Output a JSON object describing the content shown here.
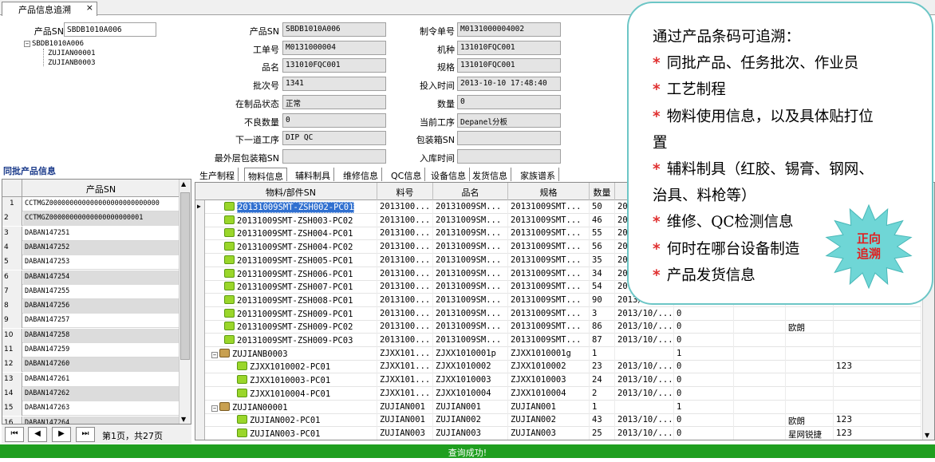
{
  "tab": {
    "title": "产品信息追溯",
    "close": "×"
  },
  "search": {
    "label": "产品SN",
    "value": "SBDB1010A006"
  },
  "tree": {
    "root": "SBDB1010A006",
    "children": [
      "ZUJIAN00001",
      "ZUJIANB0003"
    ]
  },
  "fields": [
    {
      "label": "产品SN",
      "value": "SBDB1010A006"
    },
    {
      "label": "工单号",
      "value": "M0131000004"
    },
    {
      "label": "品名",
      "value": "131010FQC001"
    },
    {
      "label": "批次号",
      "value": "1341"
    },
    {
      "label": "在制品状态",
      "value": "正常"
    },
    {
      "label": "不良数量",
      "value": "0"
    },
    {
      "label": "下一道工序",
      "value": "DIP QC"
    },
    {
      "label": "最外层包装箱SN",
      "value": ""
    }
  ],
  "fields2": [
    {
      "label": "制令单号",
      "value": "M0131000004002"
    },
    {
      "label": "机种",
      "value": "131010FQC001"
    },
    {
      "label": "规格",
      "value": "131010FQC001"
    },
    {
      "label": "投入时间",
      "value": "2013-10-10 17:48:40"
    },
    {
      "label": "数量",
      "value": "0"
    },
    {
      "label": "当前工序",
      "value": "Depanel分板"
    },
    {
      "label": "包装箱SN",
      "value": ""
    },
    {
      "label": "入库时间",
      "value": ""
    }
  ],
  "batch": {
    "title": "同批产品信息",
    "header": "产品SN",
    "rows": [
      "CCTMGZ000000000000000000000000000",
      "CCTMGZ00000000000000000000001",
      "DABAN147251",
      "DABAN147252",
      "DABAN147253",
      "DABAN147254",
      "DABAN147255",
      "DABAN147256",
      "DABAN147257",
      "DABAN147258",
      "DABAN147259",
      "DABAN147260",
      "DABAN147261",
      "DABAN147262",
      "DABAN147263",
      "DABAN147264"
    ],
    "row_nums": [
      "1",
      "2",
      "3",
      "4",
      "5",
      "6",
      "7",
      "8",
      "9",
      "10",
      "11",
      "12",
      "13",
      "14",
      "15",
      "16"
    ],
    "pager": {
      "first": "⏮",
      "prev": "◀",
      "next": "▶",
      "last": "⏭",
      "text": "第1页，共27页"
    }
  },
  "detail_tabs": [
    "生产制程",
    "物料信息",
    "辅料制具",
    "维修信息",
    "QC信息",
    "设备信息",
    "发货信息",
    "家族谱系"
  ],
  "grid": {
    "headers": [
      "物料/部件SN",
      "料号",
      "品名",
      "规格",
      "数量",
      "",
      "",
      "",
      "",
      ""
    ],
    "rows": [
      {
        "sn": "20131009SMT-ZSH002-PC01",
        "pn": "2013100...",
        "name": "20131009SM...",
        "spec": "20131009SMT...",
        "qty": "50",
        "date": "20",
        "c6": "",
        "c7": "",
        "c8": "",
        "c9": "",
        "lvl": 1,
        "kind": "pkg"
      },
      {
        "sn": "20131009SMT-ZSH003-PC02",
        "pn": "2013100...",
        "name": "20131009SM...",
        "spec": "20131009SMT...",
        "qty": "46",
        "date": "20",
        "c6": "",
        "c7": "",
        "c8": "",
        "c9": "",
        "lvl": 1,
        "kind": "pkg"
      },
      {
        "sn": "20131009SMT-ZSH004-PC01",
        "pn": "2013100...",
        "name": "20131009SM...",
        "spec": "20131009SMT...",
        "qty": "55",
        "date": "20",
        "c6": "",
        "c7": "",
        "c8": "",
        "c9": "",
        "lvl": 1,
        "kind": "pkg"
      },
      {
        "sn": "20131009SMT-ZSH004-PC02",
        "pn": "2013100...",
        "name": "20131009SM...",
        "spec": "20131009SMT...",
        "qty": "56",
        "date": "20",
        "c6": "",
        "c7": "",
        "c8": "",
        "c9": "",
        "lvl": 1,
        "kind": "pkg"
      },
      {
        "sn": "20131009SMT-ZSH005-PC01",
        "pn": "2013100...",
        "name": "20131009SM...",
        "spec": "20131009SMT...",
        "qty": "35",
        "date": "20",
        "c6": "",
        "c7": "",
        "c8": "",
        "c9": "",
        "lvl": 1,
        "kind": "pkg"
      },
      {
        "sn": "20131009SMT-ZSH006-PC01",
        "pn": "2013100...",
        "name": "20131009SM...",
        "spec": "20131009SMT...",
        "qty": "34",
        "date": "20",
        "c6": "",
        "c7": "",
        "c8": "",
        "c9": "",
        "lvl": 1,
        "kind": "pkg"
      },
      {
        "sn": "20131009SMT-ZSH007-PC01",
        "pn": "2013100...",
        "name": "20131009SM...",
        "spec": "20131009SMT...",
        "qty": "54",
        "date": "2013/",
        "c6": "",
        "c7": "",
        "c8": "",
        "c9": "",
        "lvl": 1,
        "kind": "pkg"
      },
      {
        "sn": "20131009SMT-ZSH008-PC01",
        "pn": "2013100...",
        "name": "20131009SM...",
        "spec": "20131009SMT...",
        "qty": "90",
        "date": "2013/10",
        "c6": "",
        "c7": "",
        "c8": "",
        "c9": "",
        "lvl": 1,
        "kind": "pkg"
      },
      {
        "sn": "20131009SMT-ZSH009-PC01",
        "pn": "2013100...",
        "name": "20131009SM...",
        "spec": "20131009SMT...",
        "qty": "3",
        "date": "2013/10/...",
        "c6": "0",
        "c7": "",
        "c8": "",
        "c9": "",
        "lvl": 1,
        "kind": "pkg"
      },
      {
        "sn": "20131009SMT-ZSH009-PC02",
        "pn": "2013100...",
        "name": "20131009SM...",
        "spec": "20131009SMT...",
        "qty": "86",
        "date": "2013/10/...",
        "c6": "0",
        "c7": "",
        "c8": "欧朗",
        "c9": "",
        "lvl": 1,
        "kind": "pkg"
      },
      {
        "sn": "20131009SMT-ZSH009-PC03",
        "pn": "2013100...",
        "name": "20131009SM...",
        "spec": "20131009SMT...",
        "qty": "87",
        "date": "2013/10/...",
        "c6": "0",
        "c7": "",
        "c8": "",
        "c9": "",
        "lvl": 1,
        "kind": "pkg"
      },
      {
        "sn": "ZUJIANB0003",
        "pn": "ZJXX101...",
        "name": "ZJXX1010001p",
        "spec": "ZJXX1010001g",
        "qty": "1",
        "date": "",
        "c6": "1",
        "c7": "",
        "c8": "",
        "c9": "",
        "lvl": 0,
        "kind": "box"
      },
      {
        "sn": "ZJXX1010002-PC01",
        "pn": "ZJXX101...",
        "name": "ZJXX1010002",
        "spec": "ZJXX1010002",
        "qty": "23",
        "date": "2013/10/...",
        "c6": "0",
        "c7": "",
        "c8": "",
        "c9": "123",
        "lvl": 2,
        "kind": "pkg"
      },
      {
        "sn": "ZJXX1010003-PC01",
        "pn": "ZJXX101...",
        "name": "ZJXX1010003",
        "spec": "ZJXX1010003",
        "qty": "24",
        "date": "2013/10/...",
        "c6": "0",
        "c7": "",
        "c8": "",
        "c9": "",
        "lvl": 2,
        "kind": "pkg"
      },
      {
        "sn": "ZJXX1010004-PC01",
        "pn": "ZJXX101...",
        "name": "ZJXX1010004",
        "spec": "ZJXX1010004",
        "qty": "2",
        "date": "2013/10/...",
        "c6": "0",
        "c7": "",
        "c8": "",
        "c9": "",
        "lvl": 2,
        "kind": "pkg"
      },
      {
        "sn": "ZUJIAN00001",
        "pn": "ZUJIAN001",
        "name": "ZUJIAN001",
        "spec": "ZUJIAN001",
        "qty": "1",
        "date": "",
        "c6": "1",
        "c7": "",
        "c8": "",
        "c9": "",
        "lvl": 0,
        "kind": "box"
      },
      {
        "sn": "ZUJIAN002-PC01",
        "pn": "ZUJIAN001",
        "name": "ZUJIAN002",
        "spec": "ZUJIAN002",
        "qty": "43",
        "date": "2013/10/...",
        "c6": "0",
        "c7": "",
        "c8": "欧朗",
        "c9": "123",
        "lvl": 2,
        "kind": "pkg"
      },
      {
        "sn": "ZUJIAN003-PC01",
        "pn": "ZUJIAN003",
        "name": "ZUJIAN003",
        "spec": "ZUJIAN003",
        "qty": "25",
        "date": "2013/10/...",
        "c6": "0",
        "c7": "",
        "c8": "星网锐捷",
        "c9": "123",
        "lvl": 2,
        "kind": "pkg"
      }
    ]
  },
  "status": {
    "text": "查询成功!"
  },
  "callout": {
    "lines": [
      {
        "star": "",
        "text": "通过产品条码可追溯："
      },
      {
        "star": "*",
        "text": "同批产品、任务批次、作业员"
      },
      {
        "star": "*",
        "text": "工艺制程"
      },
      {
        "star": "*",
        "text": "物料使用信息，以及具体贴打位"
      },
      {
        "star": "",
        "text": "置"
      },
      {
        "star": "*",
        "text": "辅料制具（红胶、锡膏、钢网、"
      },
      {
        "star": "",
        "text": "治具、料枪等）"
      },
      {
        "star": "*",
        "text": "维修、QC检测信息"
      },
      {
        "star": "*",
        "text": "何时在哪台设备制造"
      },
      {
        "star": "*",
        "text": "产品发货信息"
      }
    ],
    "badge": [
      "正向",
      "追溯"
    ]
  },
  "colors": {
    "status_bg": "#1f9e1f",
    "callout_border": "#6cc6c6",
    "badge_bg": "#6fd6d6",
    "badge_text": "#e02020",
    "star": "#e03030"
  }
}
